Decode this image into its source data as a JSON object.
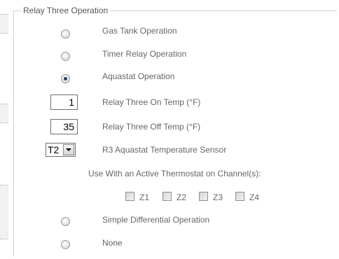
{
  "group": {
    "legend": "Relay Three Operation"
  },
  "options": {
    "gas_tank": {
      "label": "Gas Tank Operation",
      "selected": false
    },
    "timer_relay": {
      "label": "Timer Relay Operation",
      "selected": false
    },
    "aquastat": {
      "label": "Aquastat Operation",
      "selected": true
    },
    "simple_differential": {
      "label": "Simple Differential Operation",
      "selected": false
    },
    "none": {
      "label": "None",
      "selected": false
    }
  },
  "on_temp": {
    "value": "1",
    "label": "Relay Three On Temp (°F)"
  },
  "off_temp": {
    "value": "35",
    "label": "Relay Three Off Temp (°F)"
  },
  "sensor": {
    "selected": "T2",
    "label": "R3 Aquastat Temperature Sensor"
  },
  "thermostat": {
    "heading": "Use With an Active Thermostat on Channel(s):",
    "channels": [
      {
        "label": "Z1",
        "checked": false
      },
      {
        "label": "Z2",
        "checked": false
      },
      {
        "label": "Z3",
        "checked": false
      },
      {
        "label": "Z4",
        "checked": false
      }
    ]
  }
}
